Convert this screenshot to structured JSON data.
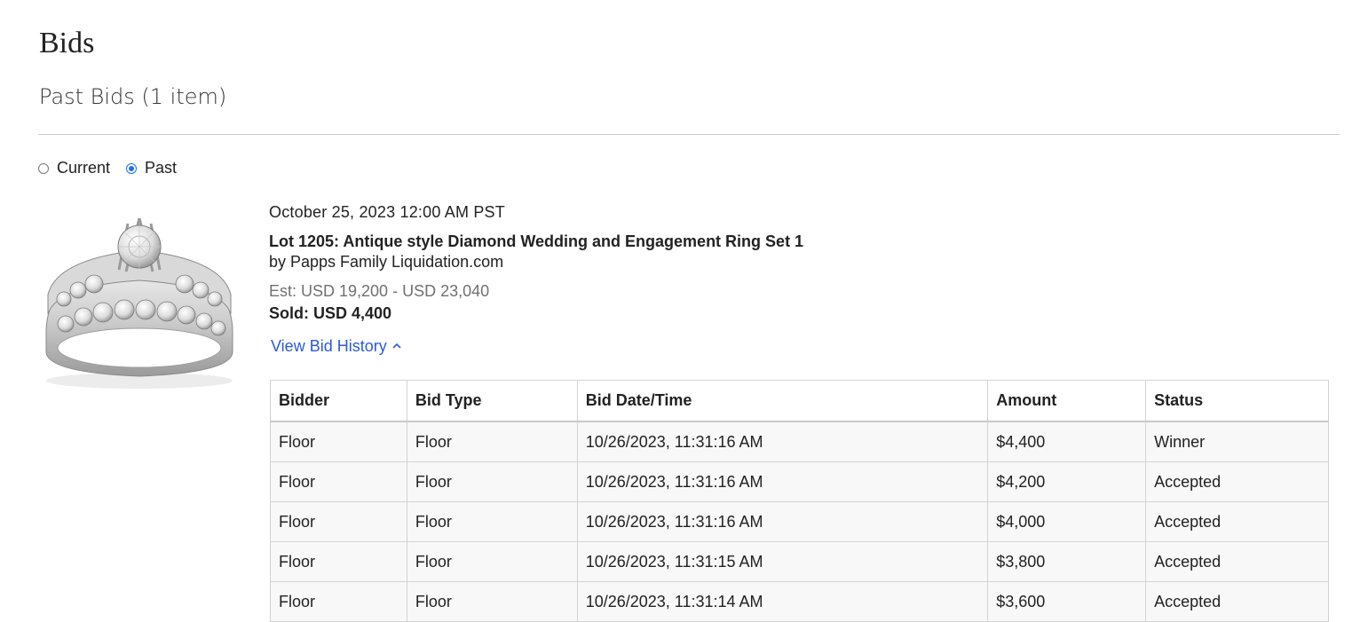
{
  "page": {
    "title": "Bids",
    "subtitle": "Past Bids (1 item)"
  },
  "filter": {
    "options": [
      {
        "label": "Current",
        "checked": false
      },
      {
        "label": "Past",
        "checked": true
      }
    ]
  },
  "lot": {
    "image_icon": "diamond-ring-image",
    "auction_date": "October 25, 2023 12:00 AM PST",
    "title": "Lot 1205: Antique style Diamond Wedding and Engagement Ring Set 1",
    "seller": "by Papps Family Liquidation.com",
    "estimate": "Est: USD 19,200 - USD 23,040",
    "sold_label": "Sold:",
    "sold_value": "USD 4,400",
    "bid_history_link": "View Bid History",
    "bid_history_icon": "chevron-up-icon"
  },
  "bid_table": {
    "headers": [
      "Bidder",
      "Bid Type",
      "Bid Date/Time",
      "Amount",
      "Status"
    ],
    "rows": [
      [
        "Floor",
        "Floor",
        "10/26/2023, 11:31:16 AM",
        "$4,400",
        "Winner"
      ],
      [
        "Floor",
        "Floor",
        "10/26/2023, 11:31:16 AM",
        "$4,200",
        "Accepted"
      ],
      [
        "Floor",
        "Floor",
        "10/26/2023, 11:31:16 AM",
        "$4,000",
        "Accepted"
      ],
      [
        "Floor",
        "Floor",
        "10/26/2023, 11:31:15 AM",
        "$3,800",
        "Accepted"
      ],
      [
        "Floor",
        "Floor",
        "10/26/2023, 11:31:14 AM",
        "$3,600",
        "Accepted"
      ]
    ]
  },
  "colors": {
    "link": "#2a5bd7",
    "radio_checked": "#1a73e8",
    "estimate_text": "#707070",
    "table_row_bg": "#f8f8f8"
  }
}
